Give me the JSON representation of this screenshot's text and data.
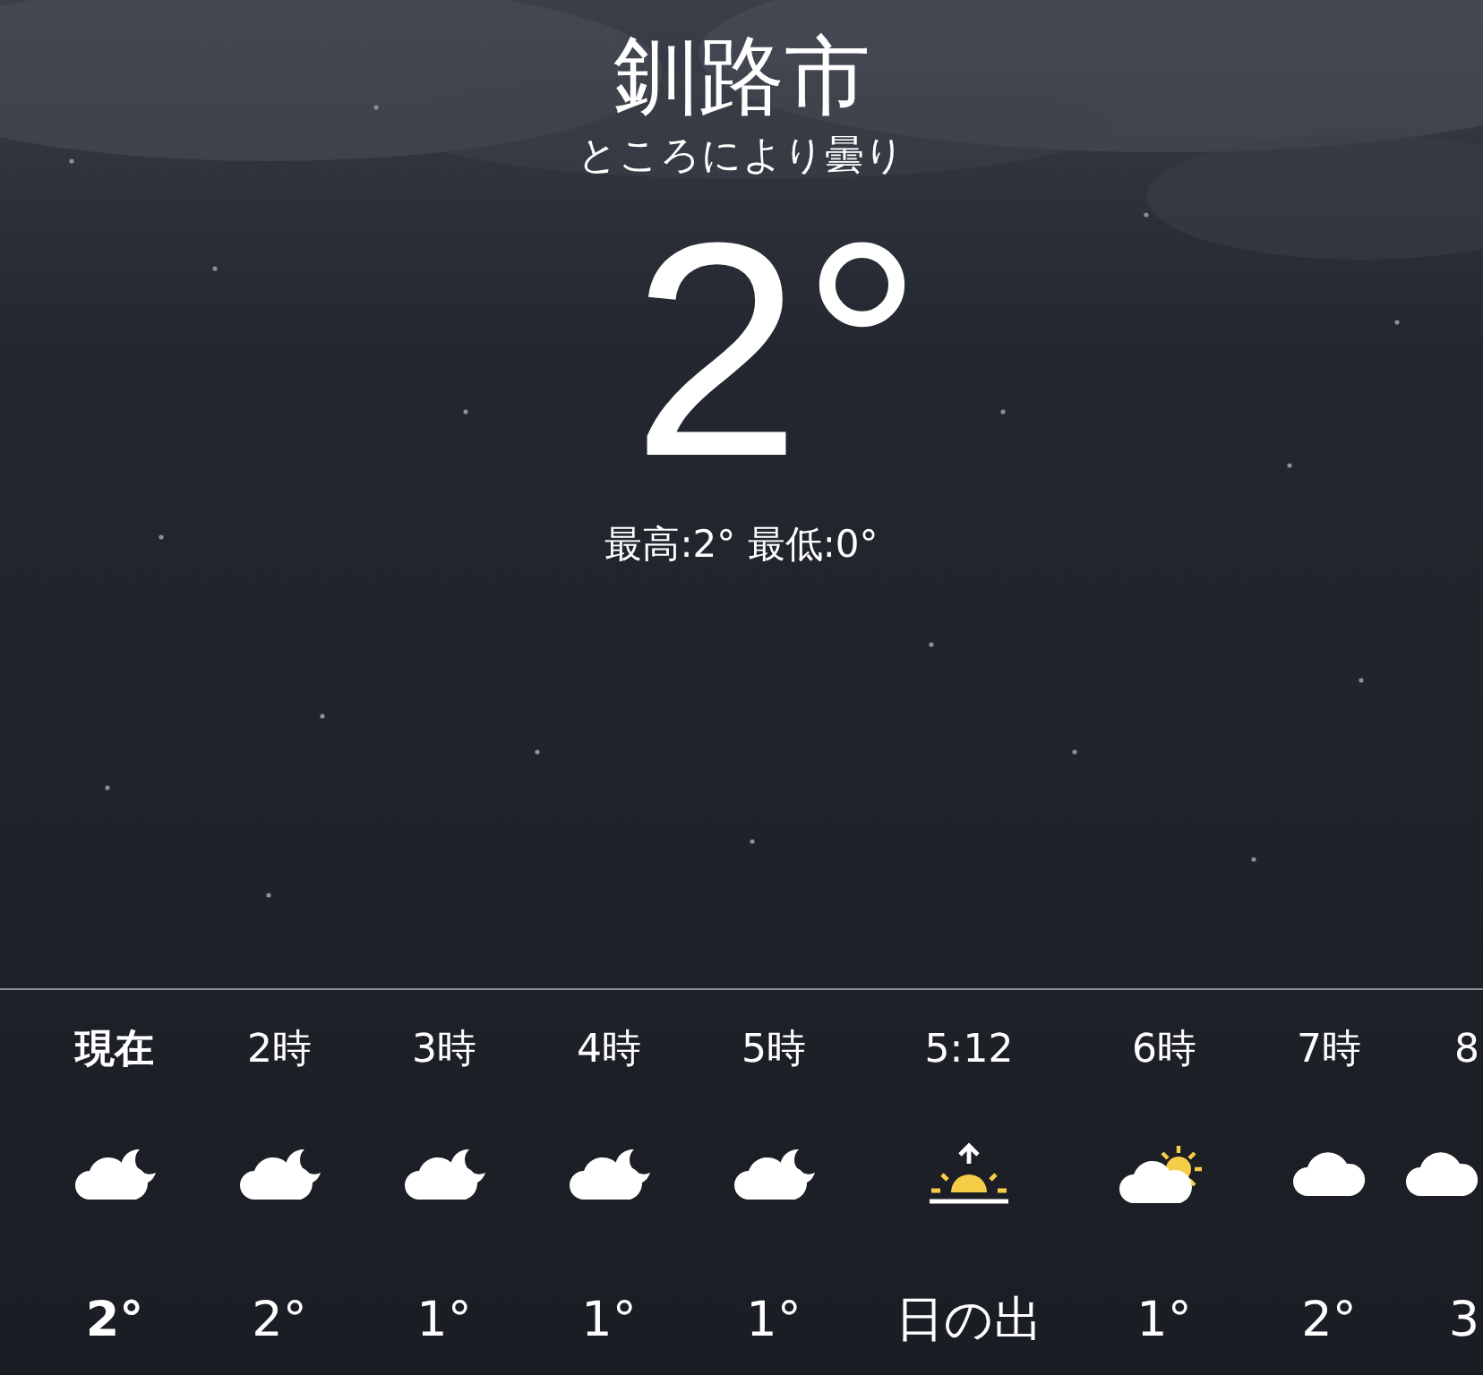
{
  "location": {
    "city": "釧路市",
    "condition": "ところにより曇り",
    "temperature": "2°",
    "high_low": "最高:2° 最低:0°"
  },
  "hourly": [
    {
      "time": "現在",
      "kind": "cloud-moon",
      "value": "2°",
      "current": true
    },
    {
      "time": "2時",
      "kind": "cloud-moon",
      "value": "2°",
      "current": false
    },
    {
      "time": "3時",
      "kind": "cloud-moon",
      "value": "1°",
      "current": false
    },
    {
      "time": "4時",
      "kind": "cloud-moon",
      "value": "1°",
      "current": false
    },
    {
      "time": "5時",
      "kind": "cloud-moon",
      "value": "1°",
      "current": false
    },
    {
      "time": "5:12",
      "kind": "sunrise",
      "value": "日の出",
      "current": false
    },
    {
      "time": "6時",
      "kind": "cloud-sun",
      "value": "1°",
      "current": false
    },
    {
      "time": "7時",
      "kind": "cloud",
      "value": "2°",
      "current": false
    },
    {
      "time": "8",
      "kind": "cloud",
      "value": "3",
      "current": false
    }
  ]
}
